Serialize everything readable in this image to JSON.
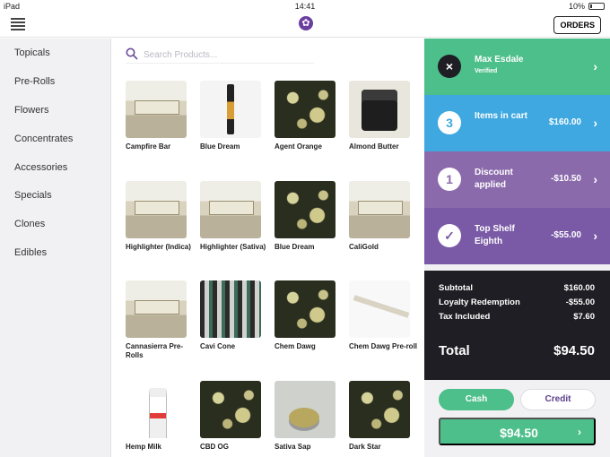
{
  "status_bar": {
    "carrier": "iPad",
    "time": "14:41",
    "battery": "10%"
  },
  "header": {
    "orders_label": "ORDERS",
    "logo_icon": "flower-logo-icon",
    "menu_icon": "hamburger-menu-icon"
  },
  "sidebar": {
    "items": [
      {
        "label": "Topicals"
      },
      {
        "label": "Pre-Rolls"
      },
      {
        "label": "Flowers"
      },
      {
        "label": "Concentrates"
      },
      {
        "label": "Accessories"
      },
      {
        "label": "Specials"
      },
      {
        "label": "Clones"
      },
      {
        "label": "Edibles"
      }
    ]
  },
  "search": {
    "placeholder": "Search Products..."
  },
  "products": [
    {
      "name": "Campfire Bar",
      "thumb": "box"
    },
    {
      "name": "Blue Dream",
      "thumb": "pen"
    },
    {
      "name": "Agent Orange",
      "thumb": "bud"
    },
    {
      "name": "Almond Butter",
      "thumb": "jar"
    },
    {
      "name": "Highlighter (Indica)",
      "thumb": "box"
    },
    {
      "name": "Highlighter (Sativa)",
      "thumb": "box"
    },
    {
      "name": "Blue Dream",
      "thumb": "bud"
    },
    {
      "name": "CaliGold",
      "thumb": "box"
    },
    {
      "name": "Cannasierra Pre-Rolls",
      "thumb": "box"
    },
    {
      "name": "Cavi Cone",
      "thumb": "cones"
    },
    {
      "name": "Chem Dawg",
      "thumb": "bud"
    },
    {
      "name": "Chem Dawg Pre-roll",
      "thumb": "stick"
    },
    {
      "name": "Hemp Milk",
      "thumb": "bottle"
    },
    {
      "name": "CBD OG",
      "thumb": "bud"
    },
    {
      "name": "Sativa Sap",
      "thumb": "sap"
    },
    {
      "name": "Dark Star",
      "thumb": "bud"
    }
  ],
  "cart": {
    "customer": {
      "name": "Max Esdale",
      "status": "Verified",
      "icon": "close-icon",
      "color": "#4dbf8a"
    },
    "items": {
      "count": "3",
      "label": "Items in cart",
      "amount": "$160.00",
      "color": "#3fa8e0"
    },
    "discount": {
      "index": "1",
      "label": "Discount applied",
      "amount": "-$10.50",
      "color": "#8b6aac"
    },
    "reward": {
      "label": "Top Shelf Eighth",
      "amount": "-$55.00",
      "icon": "checkmark-icon",
      "color": "#7a5aa6"
    },
    "summary": {
      "subtotal_label": "Subtotal",
      "subtotal": "$160.00",
      "loyalty_label": "Loyalty Redemption",
      "loyalty": "-$55.00",
      "tax_label": "Tax Included",
      "tax": "$7.60",
      "total_label": "Total",
      "total": "$94.50"
    },
    "payment": {
      "cash_label": "Cash",
      "credit_label": "Credit",
      "pay_amount": "$94.50",
      "selected": "Cash"
    }
  }
}
